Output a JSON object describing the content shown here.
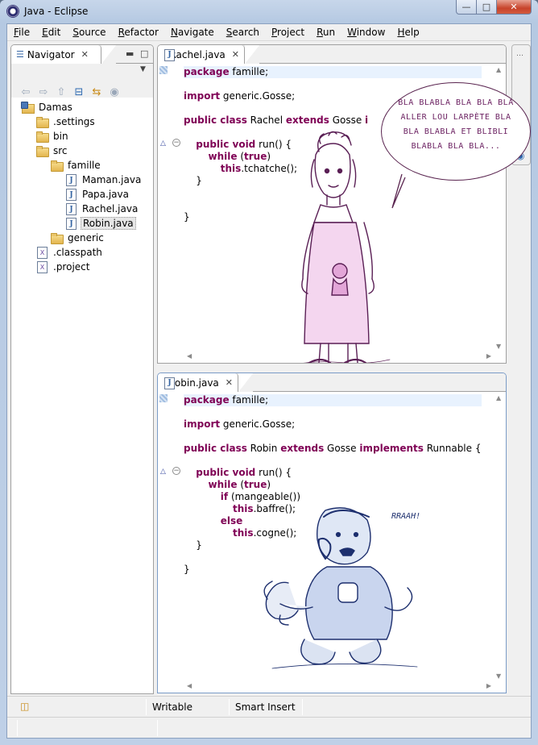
{
  "window": {
    "title": "Java - Eclipse"
  },
  "menu": [
    "File",
    "Edit",
    "Source",
    "Refactor",
    "Navigate",
    "Search",
    "Project",
    "Run",
    "Window",
    "Help"
  ],
  "navigator": {
    "title": "Navigator",
    "tree": [
      {
        "label": "Damas",
        "icon": "project-icon",
        "depth": 0
      },
      {
        "label": ".settings",
        "icon": "folder-icon",
        "depth": 1
      },
      {
        "label": "bin",
        "icon": "folder-icon",
        "depth": 1
      },
      {
        "label": "src",
        "icon": "folder-icon",
        "depth": 1
      },
      {
        "label": "famille",
        "icon": "folder-icon",
        "depth": 2
      },
      {
        "label": "Maman.java",
        "icon": "java-file-icon",
        "depth": 3
      },
      {
        "label": "Papa.java",
        "icon": "java-file-icon",
        "depth": 3
      },
      {
        "label": "Rachel.java",
        "icon": "java-file-icon",
        "depth": 3
      },
      {
        "label": "Robin.java",
        "icon": "java-file-icon",
        "depth": 3,
        "selected": true
      },
      {
        "label": "generic",
        "icon": "folder-icon",
        "depth": 2
      },
      {
        "label": ".classpath",
        "icon": "xml-file-icon",
        "depth": 1
      },
      {
        "label": ".project",
        "icon": "xml-file-icon",
        "depth": 1
      }
    ]
  },
  "editors": {
    "rachel": {
      "tab": "Rachel.java",
      "lines": [
        [
          {
            "t": "package",
            "k": 1
          },
          {
            "t": " famille;"
          }
        ],
        [],
        [
          {
            "t": "import",
            "k": 1
          },
          {
            "t": " generic.Gosse;"
          }
        ],
        [],
        [
          {
            "t": "public class",
            "k": 1
          },
          {
            "t": " Rachel "
          },
          {
            "t": "extends",
            "k": 1
          },
          {
            "t": " Gosse "
          },
          {
            "t": "i",
            "k": 1
          }
        ],
        [],
        [
          {
            "t": "    "
          },
          {
            "t": "public void",
            "k": 1
          },
          {
            "t": " run() {"
          }
        ],
        [
          {
            "t": "        "
          },
          {
            "t": "while",
            "k": 1
          },
          {
            "t": " ("
          },
          {
            "t": "true",
            "k": 1
          },
          {
            "t": ")"
          }
        ],
        [
          {
            "t": "            "
          },
          {
            "t": "this",
            "k": 1
          },
          {
            "t": ".tchatche();"
          }
        ],
        [
          {
            "t": "    }"
          }
        ],
        [],
        [],
        [
          {
            "t": "}"
          }
        ]
      ]
    },
    "robin": {
      "tab": "Robin.java",
      "lines": [
        [
          {
            "t": "package",
            "k": 1
          },
          {
            "t": " famille;"
          }
        ],
        [],
        [
          {
            "t": "import",
            "k": 1
          },
          {
            "t": " generic.Gosse;"
          }
        ],
        [],
        [
          {
            "t": "public class",
            "k": 1
          },
          {
            "t": " Robin "
          },
          {
            "t": "extends",
            "k": 1
          },
          {
            "t": " Gosse "
          },
          {
            "t": "implements",
            "k": 1
          },
          {
            "t": " Runnable {"
          }
        ],
        [],
        [
          {
            "t": "    "
          },
          {
            "t": "public void",
            "k": 1
          },
          {
            "t": " run() {"
          }
        ],
        [
          {
            "t": "        "
          },
          {
            "t": "while",
            "k": 1
          },
          {
            "t": " ("
          },
          {
            "t": "true",
            "k": 1
          },
          {
            "t": ")"
          }
        ],
        [
          {
            "t": "            "
          },
          {
            "t": "if",
            "k": 1
          },
          {
            "t": " (mangeable())"
          }
        ],
        [
          {
            "t": "                "
          },
          {
            "t": "this",
            "k": 1
          },
          {
            "t": ".baffre();"
          }
        ],
        [
          {
            "t": "            "
          },
          {
            "t": "else",
            "k": 1
          }
        ],
        [
          {
            "t": "                "
          },
          {
            "t": "this",
            "k": 1
          },
          {
            "t": ".cogne();"
          }
        ],
        [
          {
            "t": "    }"
          }
        ],
        [],
        [
          {
            "t": "}"
          }
        ]
      ]
    }
  },
  "doodles": {
    "bubble_lines": [
      "BLA BLABLA BLA BLA BLA",
      "ALLER LOU LARPÈTE BLA",
      "BLA BLABLA ET BLIBLI",
      "BLABLA BLA BLA..."
    ],
    "rraah": "RRAAH!"
  },
  "status": {
    "writable": "Writable",
    "insert_mode": "Smart Insert"
  },
  "colors": {
    "keyword": "#7f0055",
    "current_line": "#e8f2fe",
    "doodle_pink": "#6a1f60",
    "doodle_blue": "#1d2f6e"
  }
}
